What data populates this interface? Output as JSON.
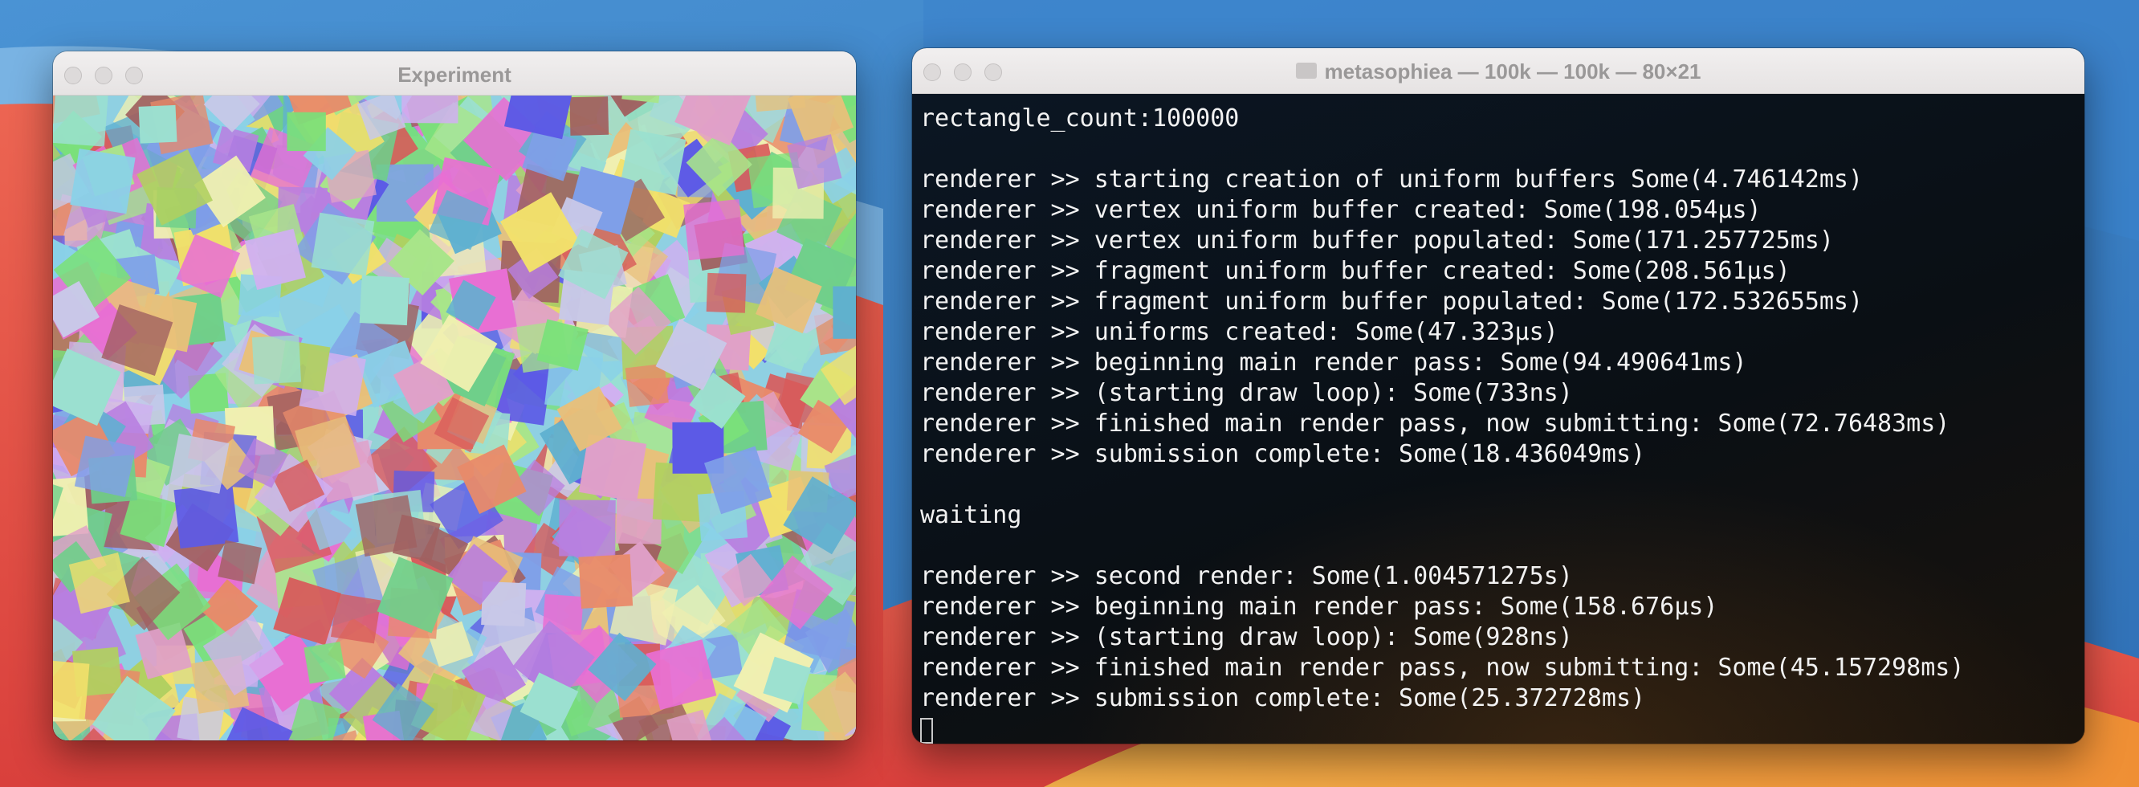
{
  "desktop": {
    "wallpaper_colors": [
      "#3f86c9",
      "#e8564a",
      "#f0a03a",
      "#c93a3a"
    ]
  },
  "experiment_window": {
    "title": "Experiment",
    "canvas_palette": [
      "#e86fd3",
      "#a8e58a",
      "#5c5ae6",
      "#f2e06b",
      "#8ad1e8",
      "#b87fe0",
      "#e88a6a",
      "#6fcf8a",
      "#d85a5a",
      "#c8c8e8",
      "#9be0d0",
      "#e8c07a",
      "#7f9fe8",
      "#e0a0c8",
      "#b0d060",
      "#5fb0d0",
      "#f0f0b0",
      "#a06060",
      "#7ae07a",
      "#d0b0f0"
    ]
  },
  "terminal_window": {
    "title": "metasophiea — 100k — 100k — 80×21",
    "title_icon": "folder-icon",
    "lines": [
      "rectangle_count:100000",
      "",
      "renderer >> starting creation of uniform buffers Some(4.746142ms)",
      "renderer >> vertex uniform buffer created: Some(198.054µs)",
      "renderer >> vertex uniform buffer populated: Some(171.257725ms)",
      "renderer >> fragment uniform buffer created: Some(208.561µs)",
      "renderer >> fragment uniform buffer populated: Some(172.532655ms)",
      "renderer >> uniforms created: Some(47.323µs)",
      "renderer >> beginning main render pass: Some(94.490641ms)",
      "renderer >> (starting draw loop): Some(733ns)",
      "renderer >> finished main render pass, now submitting: Some(72.76483ms)",
      "renderer >> submission complete: Some(18.436049ms)",
      "",
      "waiting",
      "",
      "renderer >> second render: Some(1.004571275s)",
      "renderer >> beginning main render pass: Some(158.676µs)",
      "renderer >> (starting draw loop): Some(928ns)",
      "renderer >> finished main render pass, now submitting: Some(45.157298ms)",
      "renderer >> submission complete: Some(25.372728ms)"
    ]
  }
}
